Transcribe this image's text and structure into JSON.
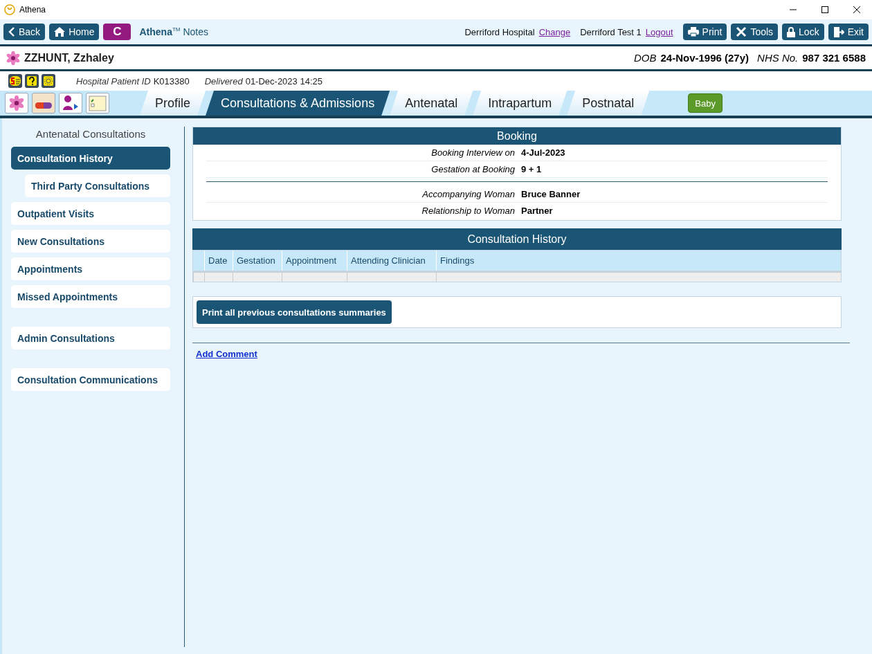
{
  "window": {
    "title": "Athena"
  },
  "toolbar": {
    "back": "Back",
    "home": "Home",
    "c_button": "C",
    "brand": "Athena",
    "brand_sup": "TM",
    "brand_suffix": "Notes",
    "hospital": "Derriford Hospital",
    "change_link": "Change",
    "user": "Derriford Test 1",
    "logout_link": "Logout",
    "buttons": [
      {
        "kind": "print",
        "label": "Print"
      },
      {
        "kind": "tools",
        "label": "Tools"
      },
      {
        "kind": "lock",
        "label": "Lock"
      },
      {
        "kind": "exit",
        "label": "Exit"
      }
    ]
  },
  "patient": {
    "name": "ZZHUNT, Zzhaley",
    "dob_label": "DOB",
    "dob": "24-Nov-1996 (27y)",
    "nhs_label": "NHS No.",
    "nhs": "987 321 6588",
    "id_label": "Hospital Patient ID",
    "id": "K013380",
    "delivered_label": "Delivered",
    "delivered": "01-Dec-2023 14:25"
  },
  "tabs": [
    {
      "label": "Profile",
      "selected": false
    },
    {
      "label": "Consultations & Admissions",
      "selected": true
    },
    {
      "label": "Antenatal",
      "selected": false
    },
    {
      "label": "Intrapartum",
      "selected": false
    },
    {
      "label": "Postnatal",
      "selected": false
    }
  ],
  "baby_button": "Baby",
  "sidebar": {
    "heading": "Antenatal Consultations",
    "groups": [
      [
        {
          "label": "Consultation History",
          "selected": true,
          "children": [
            {
              "label": "Third Party Consultations",
              "selected": false
            }
          ]
        },
        {
          "label": "Outpatient Visits",
          "selected": false
        },
        {
          "label": "New Consultations",
          "selected": false
        },
        {
          "label": "Appointments",
          "selected": false
        },
        {
          "label": "Missed Appointments",
          "selected": false
        }
      ],
      [
        {
          "label": "Admin Consultations",
          "selected": false
        }
      ],
      [
        {
          "label": "Consultation Communications",
          "selected": false
        }
      ]
    ]
  },
  "booking": {
    "title": "Booking",
    "sections": [
      [
        {
          "label": "Booking Interview on",
          "value": "4-Jul-2023"
        },
        {
          "label": "Gestation at Booking",
          "value": "9 + 1"
        }
      ],
      [
        {
          "label": "Accompanying Woman",
          "value": "Bruce Banner"
        },
        {
          "label": "Relationship to Woman",
          "value": "Partner"
        }
      ]
    ]
  },
  "history": {
    "title": "Consultation History",
    "columns": [
      "Date",
      "Gestation",
      "Appointment",
      "Attending Clinician",
      "Findings"
    ]
  },
  "print_button": "Print all previous consultations summaries",
  "add_comment": "Add Comment"
}
